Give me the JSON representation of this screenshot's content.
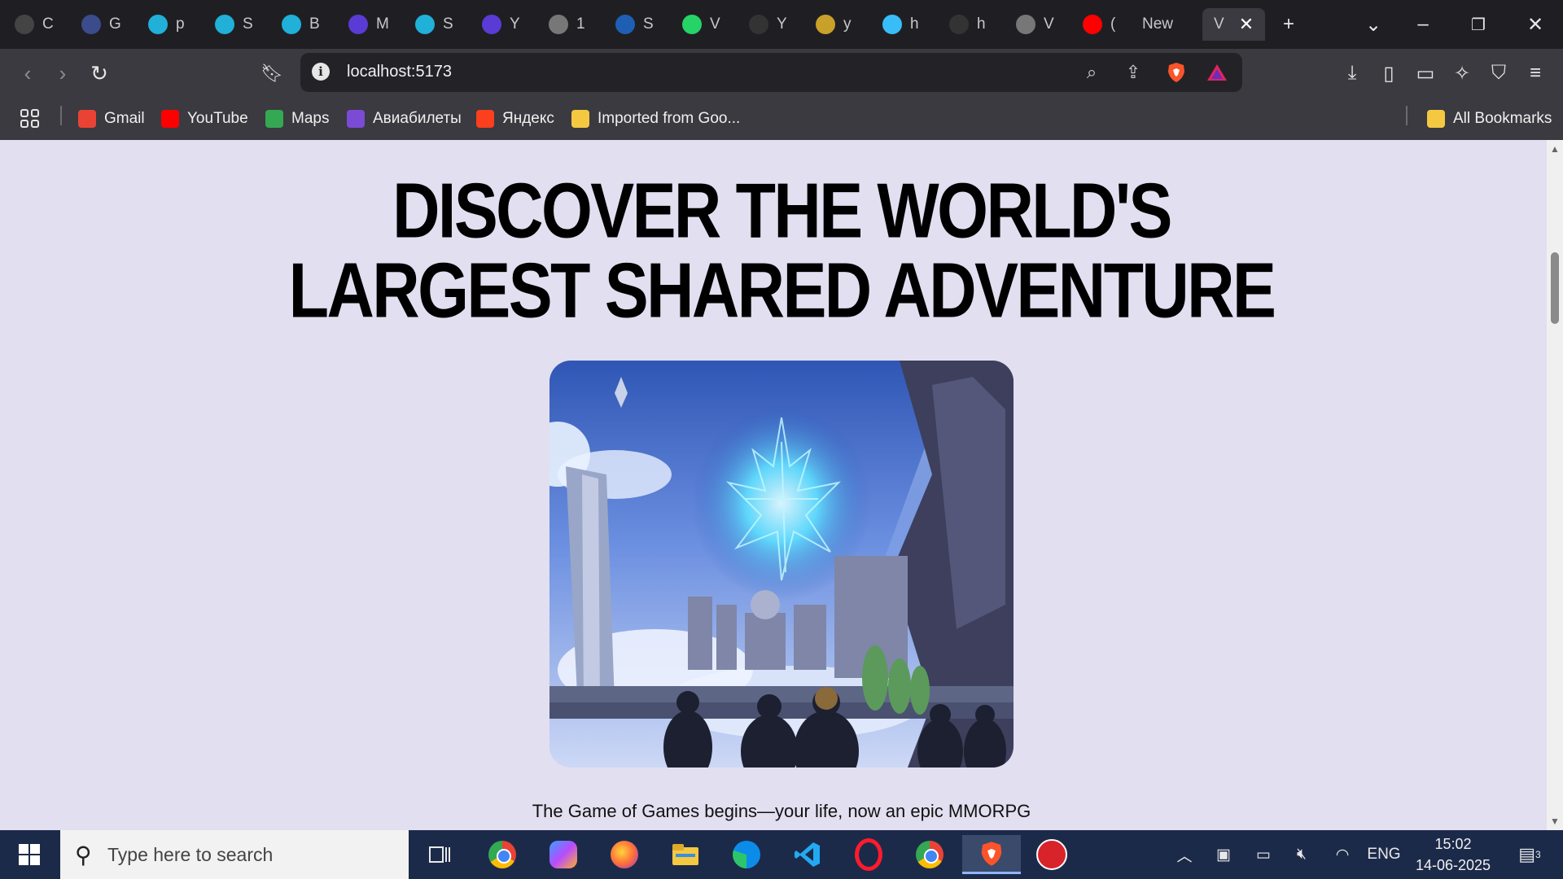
{
  "browser": {
    "tabs": [
      {
        "title": "C",
        "icon": "chatgpt-icon",
        "color": "#444"
      },
      {
        "title": "G",
        "icon": "gemini-icon",
        "color": "#3b4b8c"
      },
      {
        "title": "p",
        "icon": "canva-icon",
        "color": "#20b0d8"
      },
      {
        "title": "S",
        "icon": "canva-icon",
        "color": "#20b0d8"
      },
      {
        "title": "B",
        "icon": "canva-icon",
        "color": "#20b0d8"
      },
      {
        "title": "M",
        "icon": "video-icon",
        "color": "#5a3bd6"
      },
      {
        "title": "S",
        "icon": "canva-icon",
        "color": "#20b0d8"
      },
      {
        "title": "Y",
        "icon": "video-icon",
        "color": "#5a3bd6"
      },
      {
        "title": "1",
        "icon": "globe-icon",
        "color": "#777"
      },
      {
        "title": "S",
        "icon": "swirl-icon",
        "color": "#1e5fb4"
      },
      {
        "title": "V",
        "icon": "whatsapp-icon",
        "color": "#25d366"
      },
      {
        "title": "Y",
        "icon": "github-icon",
        "color": "#333"
      },
      {
        "title": "y",
        "icon": "bolt-icon",
        "color": "#c8a02a"
      },
      {
        "title": "h",
        "icon": "tailwind-icon",
        "color": "#38bdf8"
      },
      {
        "title": "h",
        "icon": "github-icon",
        "color": "#333"
      },
      {
        "title": "V",
        "icon": "globe-icon",
        "color": "#777"
      },
      {
        "title": "(",
        "icon": "youtube-icon",
        "color": "#ff0000"
      },
      {
        "title": "New",
        "icon": "",
        "color": ""
      },
      {
        "title": "V",
        "icon": "",
        "color": ""
      }
    ],
    "new_tab_symbol": "+",
    "address": "localhost:5173",
    "bookmarks": [
      {
        "label": "Gmail",
        "icon": "gmail-icon",
        "color": "#ea4335"
      },
      {
        "label": "YouTube",
        "icon": "youtube-icon",
        "color": "#ff0000"
      },
      {
        "label": "Maps",
        "icon": "maps-icon",
        "color": "#34a853"
      },
      {
        "label": "Авиабилеты",
        "icon": "aviasales-icon",
        "color": "#7b4bd6"
      },
      {
        "label": "Яндекс",
        "icon": "yandex-icon",
        "color": "#fc3f1d"
      },
      {
        "label": "Imported from Goo...",
        "icon": "folder-icon",
        "color": "#f5c842"
      }
    ],
    "all_bookmarks": "All Bookmarks"
  },
  "page": {
    "headline_line1": "DISCOVER THE WORLD'S",
    "headline_line2": "LARGEST SHARED ADVENTURE",
    "caption": "The Game of Games begins—your life, now an epic MMORPG"
  },
  "taskbar": {
    "search_placeholder": "Type here to search",
    "language": "ENG",
    "time": "15:02",
    "date": "14-06-2025",
    "notification_count": "3"
  }
}
